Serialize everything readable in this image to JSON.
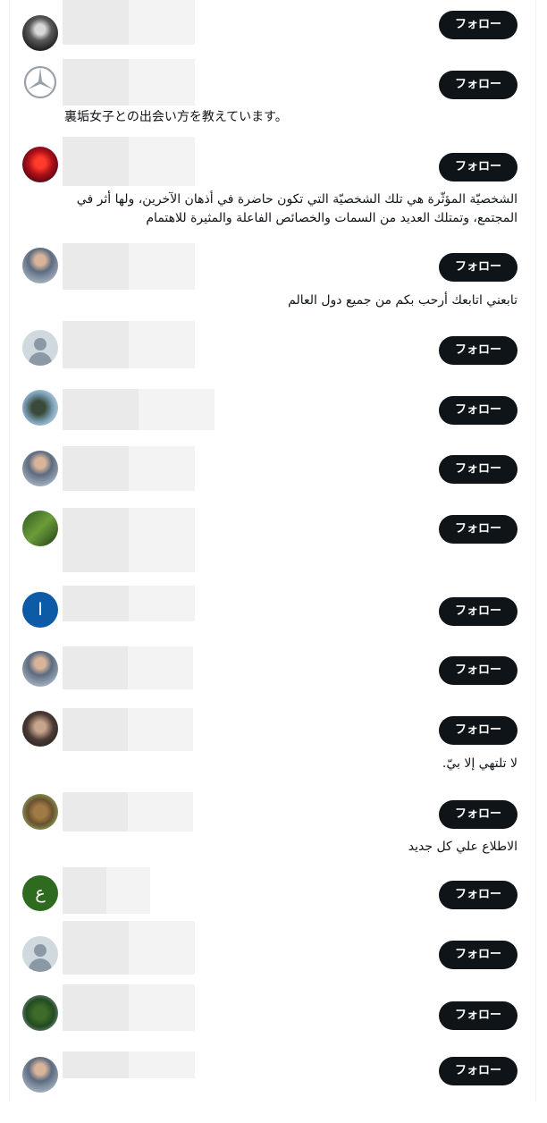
{
  "follow_label": "フォロー",
  "users": [
    {
      "avatar": "street-photo-avatar",
      "bio": "",
      "bio_dir": "ltr"
    },
    {
      "avatar": "car-logo-avatar",
      "bio": "裏垢女子との出会い方を教えています。",
      "bio_dir": "ltr"
    },
    {
      "avatar": "red-rose-avatar",
      "bio": "الشخصيّة المؤثّرة هي تلك الشخصيّة التي تكون حاضرة في أذهان الآخرين، ولها أثر في المجتمع، وتمتلك العديد من السمات والخصائص الفاعلة والمثيرة للاهتمام",
      "bio_dir": "rtl"
    },
    {
      "avatar": "person-photo-avatar",
      "bio": "تابعني اتابعك أرحب بكم من جميع دول العالم",
      "bio_dir": "rtl"
    },
    {
      "avatar": "default-user-avatar",
      "bio": "",
      "bio_dir": "ltr"
    },
    {
      "avatar": "statue-photo-avatar",
      "bio": "",
      "bio_dir": "ltr"
    },
    {
      "avatar": "person-photo-avatar",
      "bio": "",
      "bio_dir": "ltr"
    },
    {
      "avatar": "leaf-photo-avatar",
      "bio": "",
      "bio_dir": "ltr"
    },
    {
      "avatar": "letter-avatar",
      "letter": "ا",
      "color": "#0d5aa7",
      "bio": "",
      "bio_dir": "ltr"
    },
    {
      "avatar": "person-photo-avatar",
      "bio": "",
      "bio_dir": "ltr"
    },
    {
      "avatar": "couple-photo-avatar",
      "bio": "لا تلتهي إلا بيّ.",
      "bio_dir": "rtl"
    },
    {
      "avatar": "lion-photo-avatar",
      "bio": "الاطلاع علي كل جديد",
      "bio_dir": "rtl"
    },
    {
      "avatar": "letter-avatar",
      "letter": "ع",
      "color": "#2e6b1f",
      "bio": "",
      "bio_dir": "ltr"
    },
    {
      "avatar": "default-user-avatar",
      "bio": "",
      "bio_dir": "ltr"
    },
    {
      "avatar": "plant-photo-avatar",
      "bio": "",
      "bio_dir": "ltr"
    },
    {
      "avatar": "person-photo-avatar",
      "bio": "",
      "bio_dir": "ltr"
    }
  ]
}
